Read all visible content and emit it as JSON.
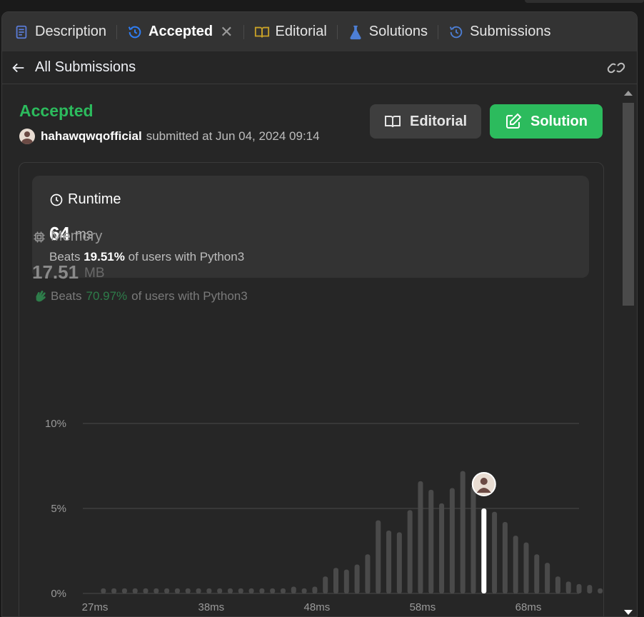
{
  "tabs": [
    {
      "label": "Description",
      "icon": "description-icon",
      "color": "#5a7bd6"
    },
    {
      "label": "Accepted",
      "icon": "history-icon",
      "color": "#2f7ef5",
      "active": true
    },
    {
      "label": "Editorial",
      "icon": "book-icon",
      "color": "#c9a227"
    },
    {
      "label": "Solutions",
      "icon": "flask-icon",
      "color": "#4d7fd6"
    },
    {
      "label": "Submissions",
      "icon": "history-icon",
      "color": "#4d7fd6"
    }
  ],
  "subbar": {
    "back_label": "All Submissions"
  },
  "submission": {
    "status": "Accepted",
    "user": "hahawqwqofficial",
    "submitted_text": "submitted at Jun 04, 2024 09:14"
  },
  "buttons": {
    "editorial": "Editorial",
    "solution": "Solution"
  },
  "runtime": {
    "title": "Runtime",
    "value": "64",
    "unit": "ms",
    "beats_prefix": "Beats",
    "beats_pct": "19.51%",
    "beats_suffix": "of users with Python3"
  },
  "memory": {
    "title": "Memory",
    "value": "17.51",
    "unit": "MB",
    "beats_prefix": "Beats",
    "beats_pct": "70.97%",
    "beats_suffix": "of users with Python3"
  },
  "colors": {
    "accent_green": "#2cbb5d",
    "bar": "#4a4a4a",
    "highlight_bar": "#ffffff"
  },
  "chart_data": {
    "type": "bar",
    "ylim": [
      0,
      10
    ],
    "y_ticks": [
      "10%",
      "5%",
      "0%"
    ],
    "x_ticks": [
      "27ms",
      "38ms",
      "48ms",
      "58ms",
      "68ms"
    ],
    "x_tick_values": [
      27,
      38,
      48,
      58,
      68
    ],
    "bar_start": 28,
    "bar_step": 1,
    "values": [
      0.3,
      0.3,
      0.3,
      0.3,
      0.3,
      0.3,
      0.3,
      0.3,
      0.3,
      0.3,
      0.3,
      0.3,
      0.3,
      0.3,
      0.3,
      0.3,
      0.3,
      0.3,
      0.4,
      0.3,
      0.4,
      1.0,
      1.5,
      1.4,
      1.7,
      2.3,
      4.3,
      3.7,
      3.6,
      4.9,
      6.6,
      6.1,
      5.3,
      6.2,
      7.2,
      6.3,
      5.0,
      4.8,
      4.2,
      3.4,
      3.0,
      2.3,
      1.8,
      1.0,
      0.7,
      0.55,
      0.5,
      0.3
    ],
    "highlight_index": 36
  }
}
